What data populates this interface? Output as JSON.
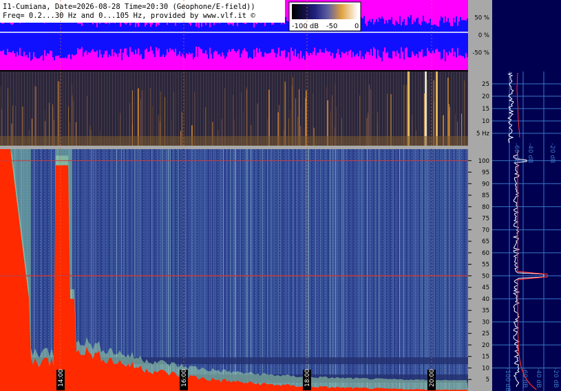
{
  "header": {
    "line1": "I1-Cumiana, Date=2026-08-28 Time=20:30 (Geophone/E-field))",
    "line2": "Freq= 0.2...30 Hz and 0...105 Hz, provided by www.vlf.it ©"
  },
  "legend": {
    "labels": [
      "-100 dB",
      "-50",
      "0"
    ]
  },
  "colors": {
    "header_bg": "#ffffff",
    "wave_bg": "#ff00ff",
    "wave_fg": "#1010ff",
    "axis_bg": "#a8a8a8",
    "side_bg": "#000050",
    "grid": "#3a78c8",
    "spec_base": "#2c3f8c",
    "low_freq_energy": "#ff2a00",
    "mains_line": "#c83c3c",
    "time_marker": "#e07040"
  },
  "chart_data": [
    {
      "type": "line",
      "title": "",
      "xlabel": "",
      "ylabel": "",
      "y_ticks": [
        "50 %",
        "0 %",
        "-50 %"
      ],
      "ylim": [
        -100,
        100
      ],
      "series": [
        {
          "x": [
            "14:00",
            "16:00",
            "18:00",
            "20:00"
          ],
          "values": [
            60,
            55,
            45,
            50
          ]
        }
      ]
    },
    {
      "type": "heatmap",
      "title": "",
      "xlabel": "",
      "ylabel": "",
      "y_ticks": [
        "25",
        "20",
        "15",
        "10",
        "5 Hz"
      ],
      "ylim": [
        0,
        30
      ]
    },
    {
      "type": "heatmap",
      "title": "",
      "xlabel": "",
      "ylabel": "",
      "x_ticks": [
        "14:00",
        "16:00",
        "18:00",
        "20:00"
      ],
      "y_ticks": [
        "100",
        "95",
        "90",
        "85",
        "80",
        "75",
        "70",
        "65",
        "60",
        "55",
        "50",
        "45",
        "40",
        "35",
        "30",
        "25",
        "20",
        "15",
        "10",
        "5"
      ],
      "ylim": [
        0,
        105
      ],
      "mains_hz": 50
    }
  ],
  "side_panels": {
    "top_labels": [
      "-60 dB",
      "-40 dB",
      "-20 dB"
    ],
    "bottom_labels": [
      "-100 dB",
      "-60 dB",
      "-40 dB",
      "-20 dB"
    ]
  }
}
